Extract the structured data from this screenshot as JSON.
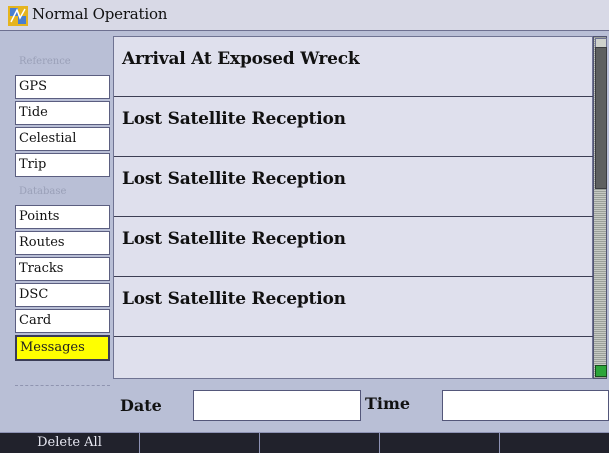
{
  "window": {
    "title": "Normal Operation",
    "icon": "compass-route-icon"
  },
  "sidebar": {
    "items": [
      {
        "label": "Reference",
        "kind": "heading"
      },
      {
        "label": "GPS",
        "kind": "item"
      },
      {
        "label": "Tide",
        "kind": "item"
      },
      {
        "label": "Celestial",
        "kind": "item"
      },
      {
        "label": "Trip",
        "kind": "item"
      },
      {
        "label": "Database",
        "kind": "heading"
      },
      {
        "label": "Points",
        "kind": "item"
      },
      {
        "label": "Routes",
        "kind": "item"
      },
      {
        "label": "Tracks",
        "kind": "item"
      },
      {
        "label": "DSC",
        "kind": "item"
      },
      {
        "label": "Card",
        "kind": "item"
      },
      {
        "label": "Messages",
        "kind": "item",
        "selected": true
      }
    ]
  },
  "messages": [
    {
      "text": "Arrival At Exposed Wreck"
    },
    {
      "text": "Lost Satellite Reception"
    },
    {
      "text": "Lost Satellite Reception"
    },
    {
      "text": "Lost Satellite Reception"
    },
    {
      "text": "Lost Satellite Reception"
    },
    {
      "text": ""
    }
  ],
  "fields": {
    "date_label": "Date",
    "date_value": "",
    "time_label": "Time",
    "time_value": ""
  },
  "softkeys": [
    "Delete All",
    "",
    "",
    "",
    "",
    ""
  ],
  "colors": {
    "selected_bg": "#ffff00",
    "softkey_bg": "#21222c",
    "scroll_end": "#2ca53a"
  }
}
